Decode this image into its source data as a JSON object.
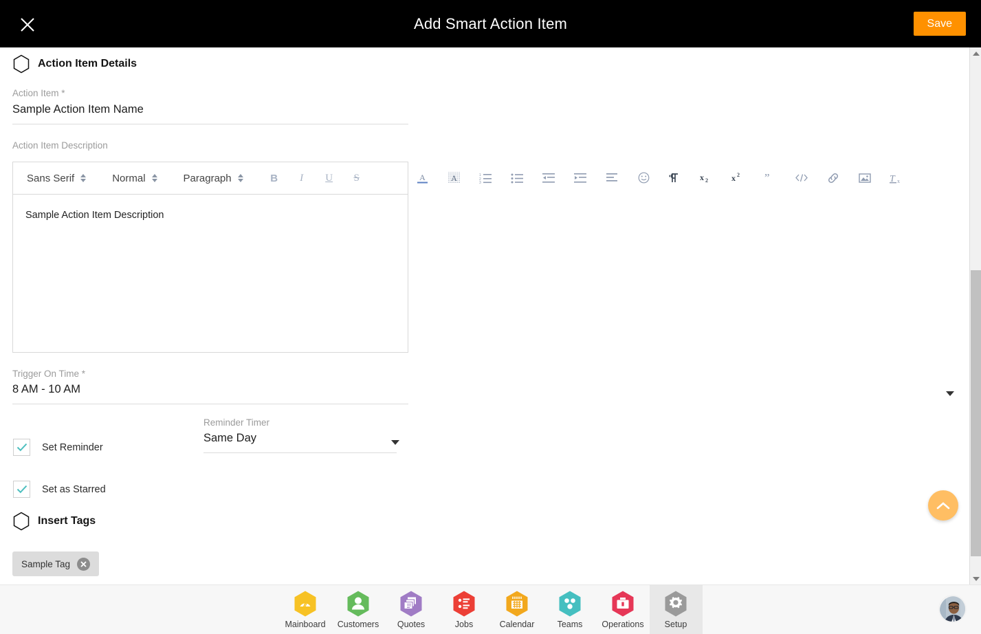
{
  "header": {
    "title": "Add Smart Action Item",
    "close_icon": "close-icon",
    "save_label": "Save",
    "accent_orange": "#ff9100",
    "background": "#000000"
  },
  "form": {
    "section_details_title": "Action Item Details",
    "action_item_label": "Action Item *",
    "action_item_value": "Sample Action Item Name",
    "description_label": "Action Item Description",
    "description_value": "Sample Action Item Description",
    "trigger_label": "Trigger On Time *",
    "trigger_value": "8 AM - 10 AM",
    "reminder_checkbox_label": "Set Reminder",
    "reminder_checked": true,
    "reminder_timer_label": "Reminder Timer",
    "reminder_timer_value": "Same Day",
    "starred_checkbox_label": "Set as Starred",
    "starred_checked": true,
    "section_tags_title": "Insert Tags",
    "tag_chip_label": "Sample Tag",
    "tag_underline_color": "#f5a623",
    "checkbox_check_color": "#4dbfbf"
  },
  "editor": {
    "font_family_value": "Sans Serif",
    "font_size_value": "Normal",
    "block_format_value": "Paragraph",
    "bold_label": "B",
    "italic_label": "I",
    "underline_label": "U",
    "strike_label": "S",
    "icons": [
      "text-color-icon",
      "background-color-icon",
      "ordered-list-icon",
      "bullet-list-icon",
      "indent-decrease-icon",
      "indent-increase-icon",
      "align-icon",
      "emoji-icon",
      "text-direction-icon",
      "subscript-icon",
      "superscript-icon",
      "blockquote-icon",
      "code-block-icon",
      "link-icon",
      "image-icon",
      "clear-format-icon"
    ]
  },
  "fab": {
    "icon": "chevron-up-icon",
    "color": "#ffbe63"
  },
  "scrollbar": {
    "up_icon": "caret-up-icon",
    "down_icon": "caret-down-icon"
  },
  "bottom_nav": {
    "items": [
      {
        "label": "Mainboard",
        "icon": "mainboard-icon",
        "color": "#f7c225",
        "active": false
      },
      {
        "label": "Customers",
        "icon": "customers-icon",
        "color": "#65bb5c",
        "active": false
      },
      {
        "label": "Quotes",
        "icon": "quotes-icon",
        "color": "#a07cc5",
        "active": false
      },
      {
        "label": "Jobs",
        "icon": "jobs-icon",
        "color": "#ec3f36",
        "active": false
      },
      {
        "label": "Calendar",
        "icon": "calendar-icon",
        "color": "#f2a81d",
        "active": false
      },
      {
        "label": "Teams",
        "icon": "teams-icon",
        "color": "#45bfc0",
        "active": false
      },
      {
        "label": "Operations",
        "icon": "operations-icon",
        "color": "#e63757",
        "active": false
      },
      {
        "label": "Setup",
        "icon": "setup-icon",
        "color": "#9a9a9a",
        "active": true
      }
    ],
    "avatar": "user-avatar"
  }
}
